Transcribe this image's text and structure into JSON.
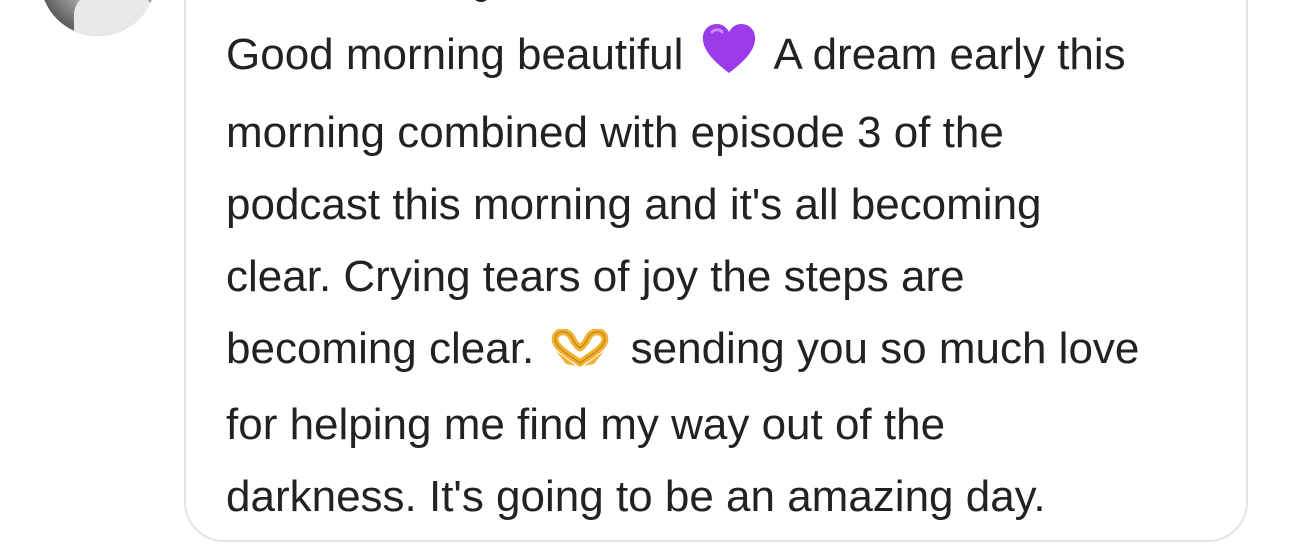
{
  "comment": {
    "lines": [
      {
        "before": "Good morning beautiful",
        "emoji": "purple-heart-icon",
        "after": "A dream early this"
      },
      {
        "text": "morning combined with episode 3 of the"
      },
      {
        "text": "podcast this morning and it's all becoming"
      },
      {
        "text": "clear. Crying tears of joy the steps are"
      },
      {
        "before": "becoming clear.",
        "emoji": "heart-hands-icon",
        "after": "sending you so much love"
      },
      {
        "text": "for helping me find my way out of the"
      },
      {
        "text": "darkness. It's going to be an amazing day."
      }
    ],
    "colors": {
      "text": "#222222",
      "bubble_border": "#e3e3e3",
      "background": "#ffffff",
      "purple_heart": "#9b3bea",
      "heart_hands": "#f2b233"
    }
  }
}
